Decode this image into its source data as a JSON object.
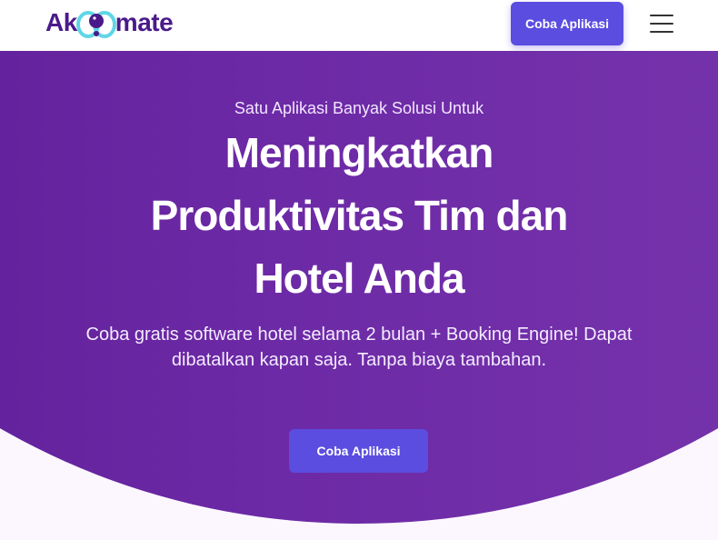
{
  "brand": {
    "name_prefix": "Ak",
    "name_suffix": "mate",
    "logo_color": "#4a1a8a",
    "accent_color": "#5b4de0"
  },
  "navbar": {
    "cta_label": "Coba Aplikasi",
    "menu_icon": "hamburger-menu-icon"
  },
  "hero": {
    "eyebrow": "Satu Aplikasi Banyak Solusi Untuk",
    "headline_line1": "Meningkatkan",
    "headline_line2": "Produktivitas Tim dan",
    "headline_line3": "Hotel Anda",
    "subtitle": "Coba gratis software hotel selama 2 bulan + Booking Engine! Dapat dibatalkan kapan saja. Tanpa biaya tambahan.",
    "cta_label": "Coba Aplikasi",
    "gradient_start": "#5a1a94",
    "gradient_end": "#7a38ae"
  }
}
